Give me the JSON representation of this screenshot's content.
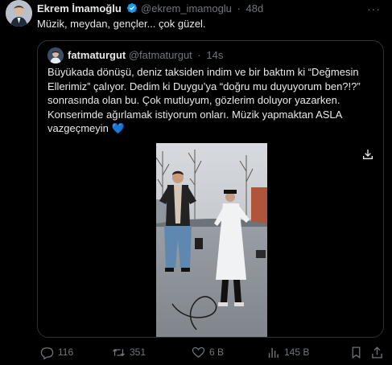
{
  "author": {
    "name": "Ekrem İmamoğlu",
    "handle": "@ekrem_imamoglu",
    "separator": "·",
    "time": "48d",
    "avatar_icon": "user-avatar-icon"
  },
  "tweet_text": "Müzik, meydan, gençler... çok güzel.",
  "more_label": "···",
  "quote": {
    "name": "fatmaturgut",
    "handle": "@fatmaturgut",
    "separator": "·",
    "time": "14s",
    "text_part1": "Büyükada dönüşü, deniz taksiden indim ve bir baktım ki “Değmesin Ellerimiz” çalıyor. Dedim ki Duygu’ya “doğru mu duyuyorum ben?!?” sonrasında olan bu. Çok mutluyum, gözlerim doluyor yazarken. Konserimde ağırlamak istiyorum onları. Müzik yapmaktan ASLA vazgeçmeyin ",
    "heart_emoji": "💙",
    "media_icon": "download-icon"
  },
  "actions": {
    "replies": "116",
    "reposts": "351",
    "likes": "6 B",
    "views": "145 B"
  },
  "colors": {
    "background": "#000000",
    "text": "#e7e9ea",
    "muted": "#71767b",
    "border": "#2f3336",
    "verified": "#1d9bf0",
    "heart": "#5da9f5"
  }
}
